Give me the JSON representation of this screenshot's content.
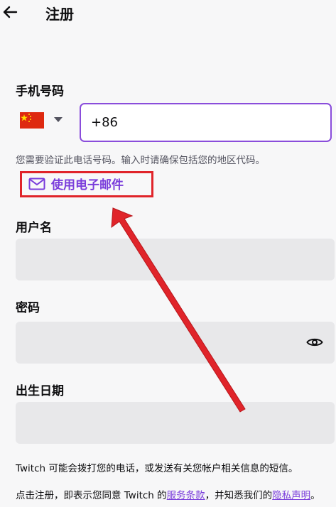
{
  "header": {
    "title": "注册",
    "back_icon": "arrow-left-icon"
  },
  "phone": {
    "label": "手机号码",
    "country_flag": "china-flag-icon",
    "dropdown_icon": "caret-down-icon",
    "value": "+86",
    "hint": "您需要验证此电话号码。输入时请确保包括您的地区代码。"
  },
  "email_link": {
    "label": "使用电子邮件",
    "icon": "mail-icon"
  },
  "username": {
    "label": "用户名",
    "value": ""
  },
  "password": {
    "label": "密码",
    "value": "",
    "toggle_icon": "eye-icon"
  },
  "birthdate": {
    "label": "出生日期",
    "value": ""
  },
  "legal": {
    "sms_notice": "Twitch 可能会拨打您的电话，或发送有关您帐户相关信息的短信。",
    "terms_prefix": "点击注册，即表示您同意 Twitch 的",
    "terms_link": "服务条款",
    "terms_middle": "，并知悉我们的",
    "privacy_link": "隐私声明",
    "terms_suffix": "。"
  },
  "colors": {
    "accent": "#8a4ddb",
    "link": "#7a3ddb",
    "annotation": "#e0242a",
    "field_bg": "#e8e8ea"
  }
}
